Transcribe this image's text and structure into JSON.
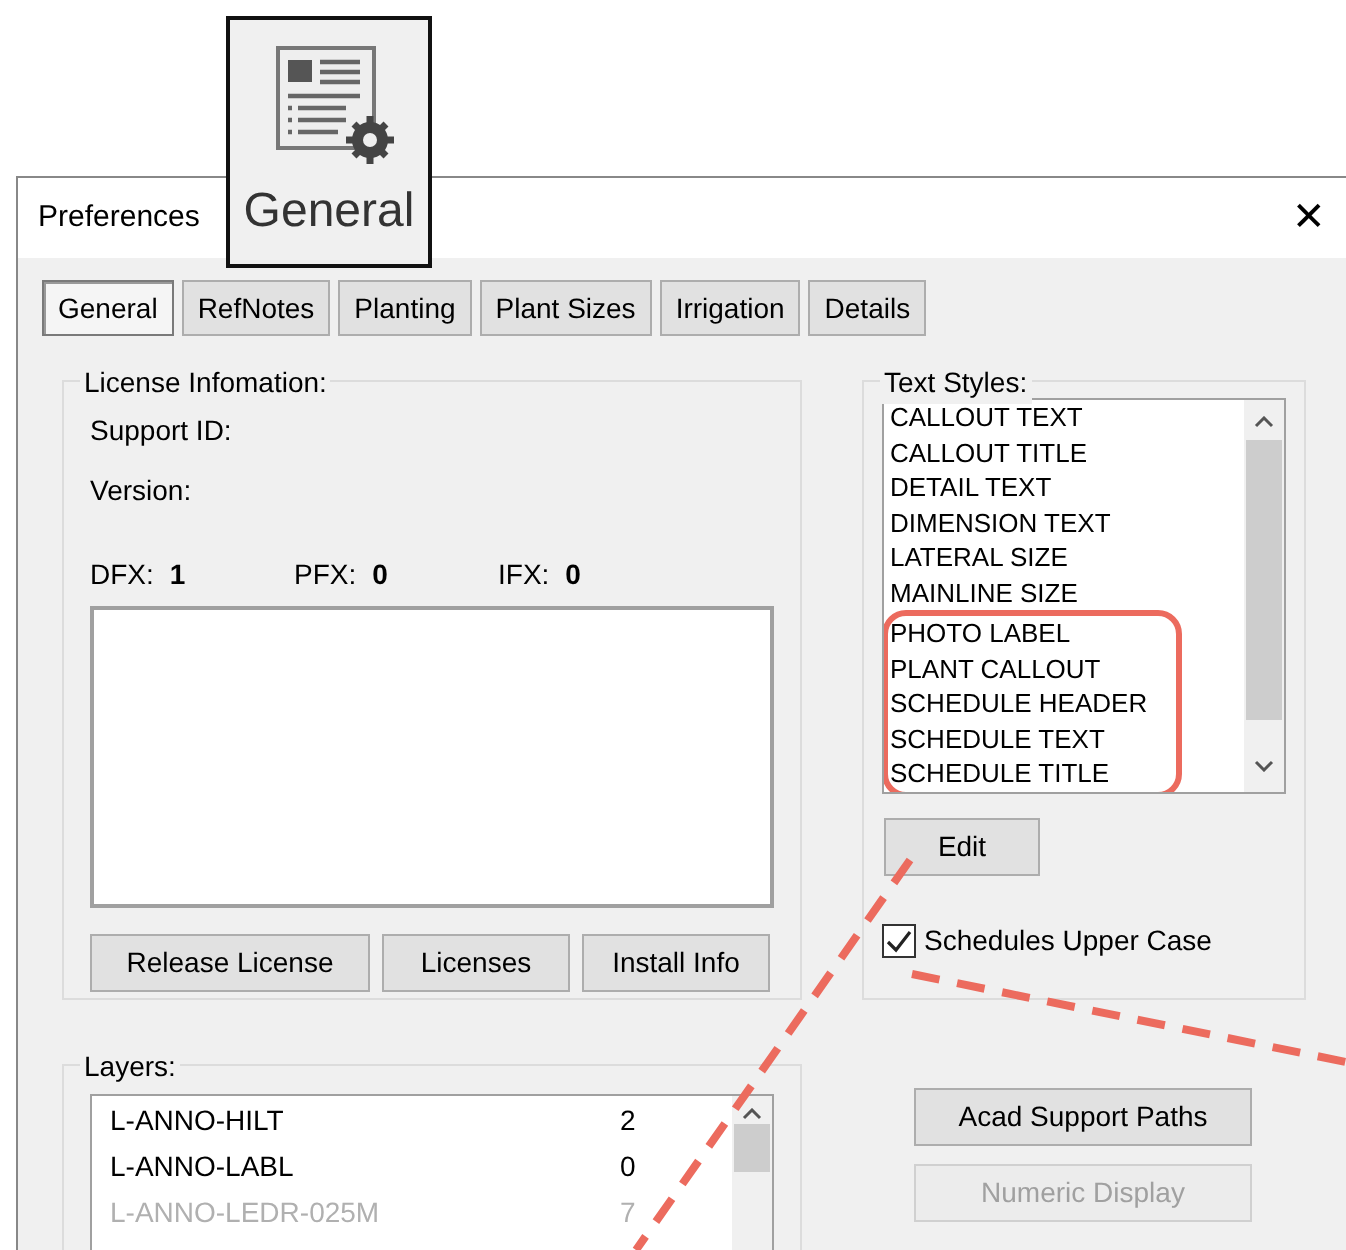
{
  "callout": {
    "label": "General"
  },
  "window": {
    "title": "Preferences",
    "close": "✕"
  },
  "tabs": [
    {
      "label": "General",
      "selected": true
    },
    {
      "label": "RefNotes",
      "selected": false
    },
    {
      "label": "Planting",
      "selected": false
    },
    {
      "label": "Plant Sizes",
      "selected": false
    },
    {
      "label": "Irrigation",
      "selected": false
    },
    {
      "label": "Details",
      "selected": false
    }
  ],
  "license": {
    "title": "License Infomation:",
    "support_id": "Support ID:",
    "version": "Version:",
    "counts": [
      {
        "label": "DFX:",
        "value": "1"
      },
      {
        "label": "PFX:",
        "value": "0"
      },
      {
        "label": "IFX:",
        "value": "0"
      }
    ],
    "buttons": [
      "Release License",
      "Licenses",
      "Install Info"
    ]
  },
  "text_styles": {
    "title": "Text Styles:",
    "items": [
      {
        "name": "CALLOUT TEXT",
        "highlighted": false
      },
      {
        "name": "CALLOUT TITLE",
        "highlighted": false
      },
      {
        "name": "DETAIL TEXT",
        "highlighted": false
      },
      {
        "name": "DIMENSION TEXT",
        "highlighted": false
      },
      {
        "name": "LATERAL SIZE",
        "highlighted": false
      },
      {
        "name": "MAINLINE SIZE",
        "highlighted": false
      },
      {
        "name": "PHOTO LABEL",
        "highlighted": true
      },
      {
        "name": "PLANT CALLOUT",
        "highlighted": true
      },
      {
        "name": "SCHEDULE HEADER",
        "highlighted": true
      },
      {
        "name": "SCHEDULE TEXT",
        "highlighted": true
      },
      {
        "name": "SCHEDULE TITLE",
        "highlighted": true
      }
    ],
    "edit_button": "Edit",
    "upper_case": {
      "label": "Schedules Upper Case",
      "checked": true
    }
  },
  "layers": {
    "title": "Layers:",
    "rows": [
      {
        "name": "L-ANNO-HILT",
        "count": "2",
        "dimmed": false
      },
      {
        "name": "L-ANNO-LABL",
        "count": "0",
        "dimmed": false
      },
      {
        "name": "L-ANNO-LEDR-025M",
        "count": "7",
        "dimmed": true
      }
    ]
  },
  "side_buttons": [
    {
      "label": "Acad Support Paths",
      "disabled": false
    },
    {
      "label": "Numeric Display",
      "disabled": true
    }
  ]
}
